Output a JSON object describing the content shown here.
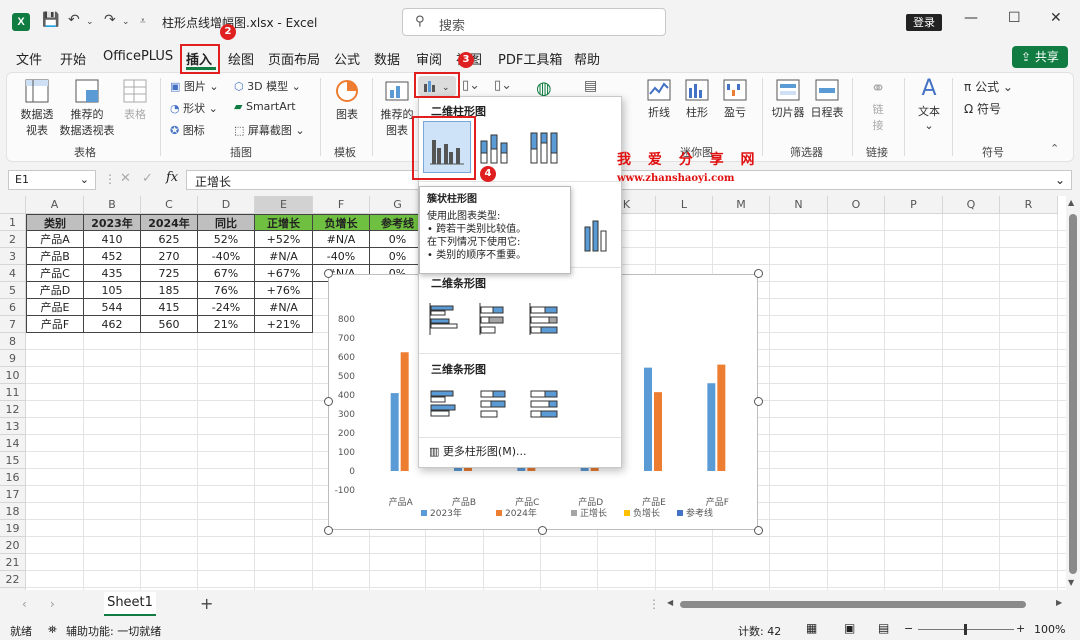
{
  "window": {
    "title": "柱形点线增幅图.xlsx - Excel",
    "search_placeholder": "搜索",
    "login": "登录"
  },
  "menu": [
    "文件",
    "开始",
    "OfficePLUS",
    "插入",
    "绘图",
    "页面布局",
    "公式",
    "数据",
    "审阅",
    "视图",
    "PDF工具箱",
    "帮助"
  ],
  "share": "共享",
  "ribbon": {
    "pivot": "数据透视表",
    "pivot_a": "数据透",
    "pivot_b": "视表",
    "rec_pivot_a": "推荐的",
    "rec_pivot_b": "数据透视表",
    "table": "表格",
    "grp_tables": "表格",
    "picture": "图片",
    "shapes": "形状",
    "icons": "图标",
    "model3d": "3D 模型",
    "smartart": "SmartArt",
    "screenshot": "屏幕截图",
    "grp_illus": "插图",
    "chart": "图表",
    "grp_template": "模板",
    "rec_chart_a": "推荐的",
    "rec_chart_b": "图表",
    "line": "折线",
    "column": "柱形",
    "winloss": "盈亏",
    "grp_spark": "迷你图",
    "slicer": "切片器",
    "timeline": "日程表",
    "grp_filter": "筛选器",
    "link_a": "链",
    "link_b": "接",
    "grp_link": "链接",
    "text": "文本",
    "formula": "公式",
    "symbol": "符号",
    "grp_symbol": "符号"
  },
  "formula_bar": {
    "cell": "E1",
    "fx": "fx",
    "value": "正增长"
  },
  "columns": [
    "A",
    "B",
    "C",
    "D",
    "E",
    "F",
    "G",
    "H",
    "I",
    "J",
    "K",
    "L",
    "M",
    "N",
    "O",
    "P",
    "Q",
    "R"
  ],
  "rows": [
    "1",
    "2",
    "3",
    "4",
    "5",
    "6",
    "7",
    "8",
    "9",
    "10",
    "11",
    "12",
    "13",
    "14",
    "15",
    "16",
    "17",
    "18",
    "19",
    "20",
    "21",
    "22",
    "23"
  ],
  "table": {
    "headers": [
      "类别",
      "2023年",
      "2024年",
      "同比",
      "正增长",
      "负增长",
      "参考线"
    ],
    "data": [
      [
        "产品A",
        "410",
        "625",
        "52%",
        "+52%",
        "#N/A",
        "0%"
      ],
      [
        "产品B",
        "452",
        "270",
        "-40%",
        "#N/A",
        "-40%",
        "0%"
      ],
      [
        "产品C",
        "435",
        "725",
        "67%",
        "+67%",
        "#N/A",
        "0%"
      ],
      [
        "产品D",
        "105",
        "185",
        "76%",
        "+76%",
        "",
        ""
      ],
      [
        "产品E",
        "544",
        "415",
        "-24%",
        "#N/A",
        "",
        ""
      ],
      [
        "产品F",
        "462",
        "560",
        "21%",
        "+21%",
        "",
        ""
      ]
    ]
  },
  "chart_data": {
    "type": "bar",
    "categories": [
      "产品A",
      "产品B",
      "产品C",
      "产品D",
      "产品E",
      "产品F"
    ],
    "series": [
      {
        "name": "2023年",
        "color": "#5b9bd5",
        "values": [
          410,
          452,
          435,
          105,
          544,
          462
        ]
      },
      {
        "name": "2024年",
        "color": "#ed7d31",
        "values": [
          625,
          270,
          725,
          185,
          415,
          560
        ]
      },
      {
        "name": "正增长",
        "color": "#a5a5a5",
        "values": [
          0.52,
          null,
          0.67,
          0.76,
          null,
          0.21
        ]
      },
      {
        "name": "负增长",
        "color": "#ffc000",
        "values": [
          null,
          -0.4,
          null,
          null,
          -0.24,
          null
        ]
      },
      {
        "name": "参考线",
        "color": "#4472c4",
        "values": [
          0,
          0,
          0,
          0,
          0,
          0
        ]
      }
    ],
    "yticks": [
      "800",
      "700",
      "600",
      "500",
      "400",
      "300",
      "200",
      "100",
      "0",
      "-100"
    ],
    "ylim": [
      -100,
      800
    ],
    "legend": "bottom"
  },
  "gallery": {
    "sec1": "二维柱形图",
    "sec2_partial": "三",
    "sec3": "二维条形图",
    "sec4": "三维条形图",
    "more": "更多柱形图(M)..."
  },
  "tooltip": {
    "title": "簇状柱形图",
    "lines": [
      "使用此图表类型:",
      "• 跨若干类别比较值。",
      "在下列情况下使用它:",
      "• 类别的顺序不重要。"
    ]
  },
  "annotations": {
    "b2": "2",
    "b3": "3",
    "b4": "4"
  },
  "watermark": {
    "cn": "我 爱 分 享 网",
    "url": "www.zhanshaoyi.com"
  },
  "sheet_tab": "Sheet1",
  "status": {
    "ready": "就绪",
    "access": "辅助功能: 一切就绪",
    "count": "计数: 42",
    "zoom": "100%"
  }
}
